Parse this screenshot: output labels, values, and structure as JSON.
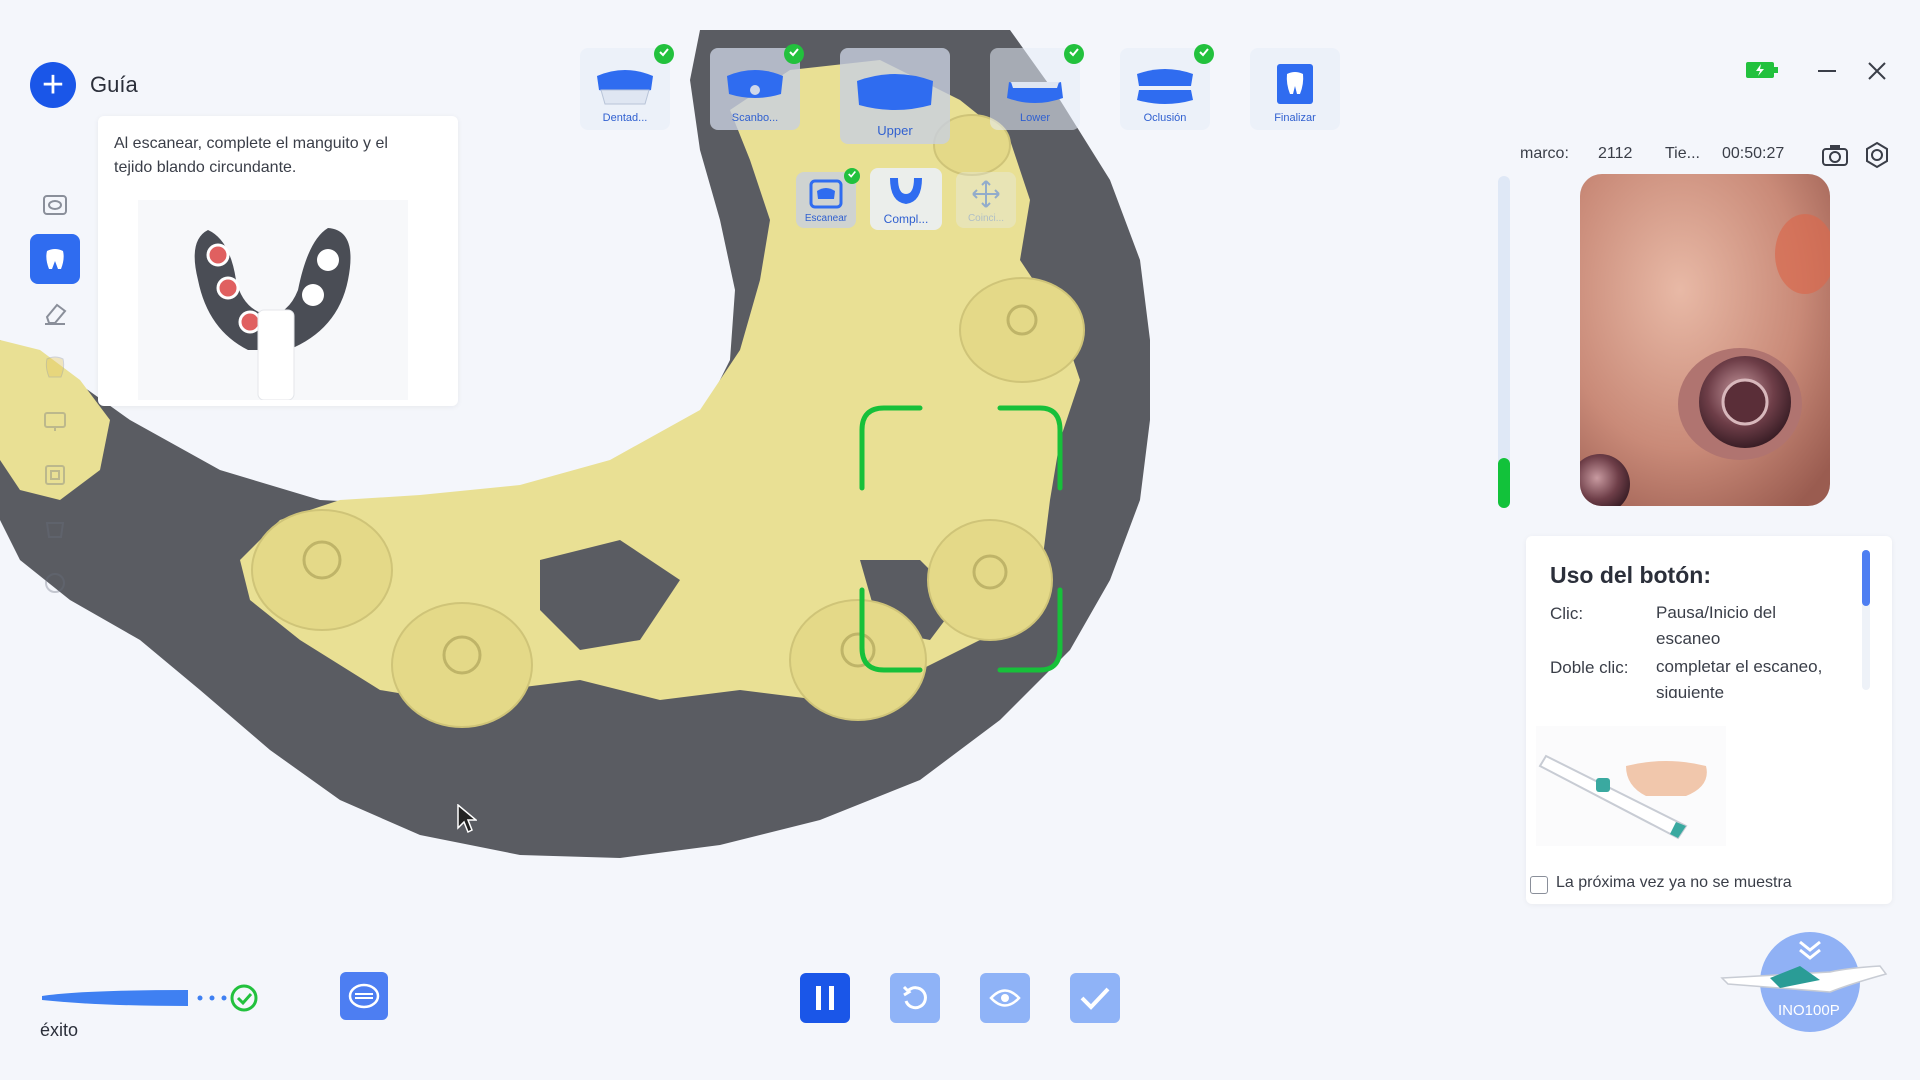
{
  "guide": {
    "title": "Guía",
    "text": "Al escanear, complete el manguito y el tejido blando circundante."
  },
  "workflow": {
    "items": [
      {
        "label": "Dentad...",
        "done": true
      },
      {
        "label": "Scanbo...",
        "done": true
      },
      {
        "label": "Upper",
        "done": false
      },
      {
        "label": "Lower",
        "done": true
      },
      {
        "label": "Oclusión",
        "done": true
      },
      {
        "label": "Finalizar",
        "done": false
      }
    ],
    "substeps": [
      {
        "label": "Escanear",
        "done": true
      },
      {
        "label": "Compl...",
        "done": false
      },
      {
        "label": "Coinci...",
        "done": false
      }
    ]
  },
  "info": {
    "frame_label": "marco:",
    "frame_value": "2112",
    "time_label": "Tie...",
    "time_value": "00:50:27"
  },
  "scan_progress": 0.15,
  "help": {
    "title": "Uso del botón:",
    "click_label": "Clic:",
    "click_value": "Pausa/Inicio del escaneo",
    "dbl_label": "Doble clic:",
    "dbl_value": "completar el escaneo, siguiente",
    "checkbox_label": "La próxima vez ya no se muestra"
  },
  "status": {
    "text": "éxito"
  },
  "device": {
    "model": "INO100P"
  },
  "colors": {
    "accent": "#1a56e8",
    "success": "#22c13d",
    "scan_gum": "#585a60",
    "scan_tooth": "#e8df8e"
  }
}
